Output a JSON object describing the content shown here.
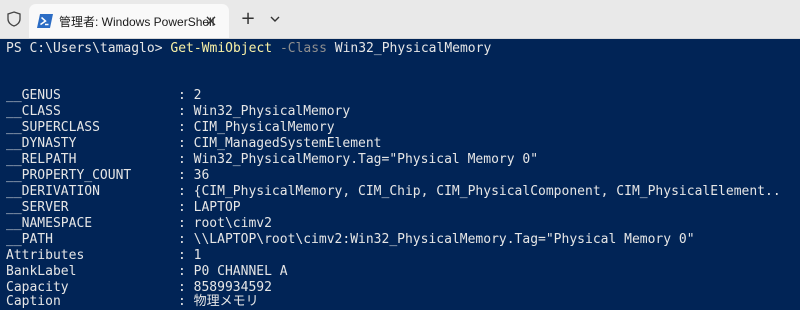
{
  "window": {
    "tab_title": "管理者: Windows PowerShell",
    "tab_close": "×",
    "new_tab": "+",
    "icons": [
      "shield-icon",
      "powershell-icon",
      "close-icon",
      "plus-icon",
      "chevron-down-icon"
    ],
    "colors": {
      "console_bg": "#012456",
      "titlebar_bg": "#e9e9e9",
      "command": "#f9f1a5",
      "parameter": "#8f8f8f"
    }
  },
  "console": {
    "prompt": "PS C:\\Users\\tamaglo> ",
    "command": "Get-WmiObject",
    "parameter": "-Class",
    "argument": "Win32_PhysicalMemory",
    "sep": ": ",
    "rows": [
      {
        "key": "__GENUS",
        "value": "2"
      },
      {
        "key": "__CLASS",
        "value": "Win32_PhysicalMemory"
      },
      {
        "key": "__SUPERCLASS",
        "value": "CIM_PhysicalMemory"
      },
      {
        "key": "__DYNASTY",
        "value": "CIM_ManagedSystemElement"
      },
      {
        "key": "__RELPATH",
        "value": "Win32_PhysicalMemory.Tag=\"Physical Memory 0\""
      },
      {
        "key": "__PROPERTY_COUNT",
        "value": "36"
      },
      {
        "key": "__DERIVATION",
        "value": "{CIM_PhysicalMemory, CIM_Chip, CIM_PhysicalComponent, CIM_PhysicalElement.."
      },
      {
        "key": "__SERVER",
        "value": "LAPTOP"
      },
      {
        "key": "__NAMESPACE",
        "value": "root\\cimv2"
      },
      {
        "key": "__PATH",
        "value": "\\\\LAPTOP\\root\\cimv2:Win32_PhysicalMemory.Tag=\"Physical Memory 0\""
      },
      {
        "key": "Attributes",
        "value": "1"
      },
      {
        "key": "BankLabel",
        "value": "P0 CHANNEL A"
      },
      {
        "key": "Capacity",
        "value": "8589934592"
      },
      {
        "key": "Caption",
        "value": "物理メモリ"
      }
    ]
  }
}
